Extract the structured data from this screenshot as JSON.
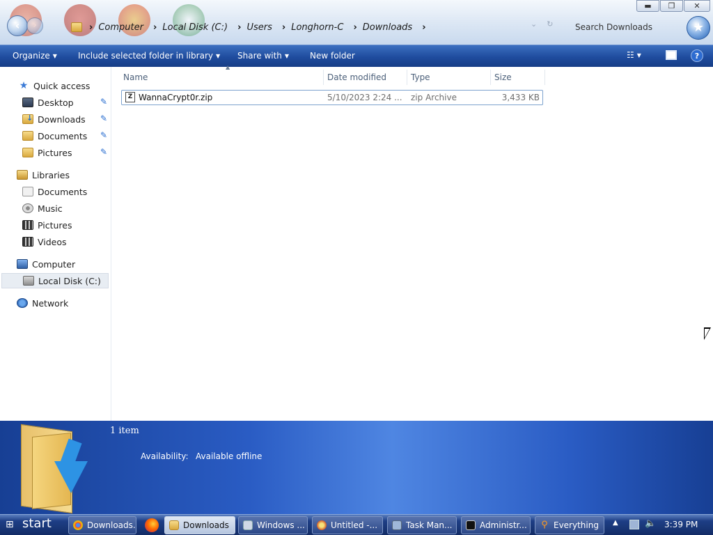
{
  "window": {
    "breadcrumb": [
      "Computer",
      "Local Disk (C:)",
      "Users",
      "Longhorn-C",
      "Downloads"
    ],
    "search_placeholder": "Search Downloads",
    "controls": {
      "minimize": "▬",
      "maximize": "❐",
      "close": "✕"
    }
  },
  "toolbar": {
    "organize": "Organize",
    "include_library": "Include selected folder in library",
    "share_with": "Share with",
    "new_folder": "New folder",
    "help": "?"
  },
  "sidebar": {
    "quick_access": "Quick access",
    "quick_items": [
      {
        "label": "Desktop",
        "icon": "desktop-icon",
        "pinned": true
      },
      {
        "label": "Downloads",
        "icon": "downloads-folder-icon",
        "pinned": true
      },
      {
        "label": "Documents",
        "icon": "folder-icon",
        "pinned": true
      },
      {
        "label": "Pictures",
        "icon": "pictures-folder-icon",
        "pinned": true
      }
    ],
    "libraries": "Libraries",
    "library_items": [
      {
        "label": "Documents",
        "icon": "documents-library-icon"
      },
      {
        "label": "Music",
        "icon": "music-library-icon"
      },
      {
        "label": "Pictures",
        "icon": "pictures-library-icon"
      },
      {
        "label": "Videos",
        "icon": "videos-library-icon"
      }
    ],
    "computer": "Computer",
    "computer_items": [
      {
        "label": "Local Disk (C:)",
        "icon": "drive-icon",
        "selected": true
      }
    ],
    "network": "Network"
  },
  "filelist": {
    "columns": [
      "Name",
      "Date modified",
      "Type",
      "Size"
    ],
    "rows": [
      {
        "name": "WannaCrypt0r.zip",
        "date": "5/10/2023 2:24 ...",
        "type": "zip Archive",
        "size": "3,433 KB"
      }
    ]
  },
  "details": {
    "item_count": "1 item",
    "availability_label": "Availability:",
    "availability_value": "Available offline"
  },
  "taskbar": {
    "start": "start",
    "buttons": [
      {
        "label": "Downloads...",
        "icon": "chrome-icon",
        "active": false
      },
      {
        "label": "Downloads",
        "icon": "folder-icon",
        "active": true
      },
      {
        "label": "Windows ...",
        "icon": "window-icon",
        "active": false
      },
      {
        "label": "Untitled -...",
        "icon": "paint-icon",
        "active": false
      },
      {
        "label": "Task Man...",
        "icon": "task-manager-icon",
        "active": false
      },
      {
        "label": "Administr...",
        "icon": "cmd-icon",
        "active": false
      },
      {
        "label": "Everything",
        "icon": "search-icon",
        "active": false
      }
    ],
    "clock": "3:39 PM"
  }
}
